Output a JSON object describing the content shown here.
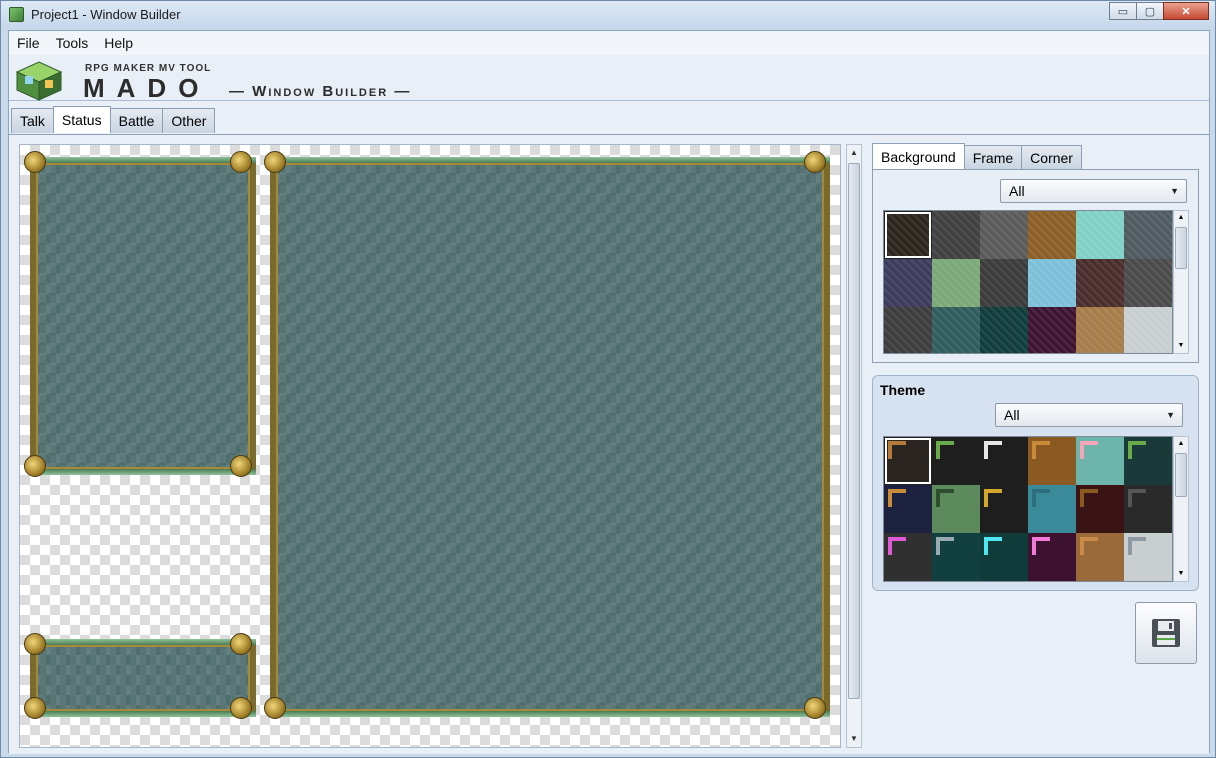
{
  "window": {
    "title": "Project1 - Window Builder",
    "minimize": "▭",
    "maximize": "▢",
    "close": "✕"
  },
  "menu": [
    "File",
    "Tools",
    "Help"
  ],
  "banner": {
    "subtitle": "RPG MAKER MV TOOL",
    "name": "MADO",
    "tagline": "— Window Builder —"
  },
  "tabs": [
    "Talk",
    "Status",
    "Battle",
    "Other"
  ],
  "active_tab": "Status",
  "right_tabs": [
    "Background",
    "Frame",
    "Corner"
  ],
  "active_right_tab": "Background",
  "background": {
    "filter": "All",
    "swatches": [
      "#2a241c",
      "#3f3f3f",
      "#5a5a5a",
      "#8b5d25",
      "#7fd1c6",
      "#4d5a5f",
      "#3b3a5c",
      "#7aa876",
      "#3a3a3a",
      "#7cc0d8",
      "#4a2c2c",
      "#4a4a4a",
      "#3c3c3c",
      "#2f5c5c",
      "#0f3b3b",
      "#3d1230",
      "#a67c4a",
      "#c9ced1"
    ]
  },
  "theme": {
    "title": "Theme",
    "filter": "All",
    "swatches": [
      {
        "bg": "#2a2520",
        "accent": "#b57b3a"
      },
      {
        "bg": "#1e1e1e",
        "accent": "#6aaa4a"
      },
      {
        "bg": "#1e1e1e",
        "accent": "#e6e6e6"
      },
      {
        "bg": "#8b5a22",
        "accent": "#c98a3a"
      },
      {
        "bg": "#6db5ab",
        "accent": "#f2a6b8"
      },
      {
        "bg": "#1a3a3a",
        "accent": "#6aaa4a"
      },
      {
        "bg": "#1d2240",
        "accent": "#c98a3a"
      },
      {
        "bg": "#5c8a5c",
        "accent": "#2e4e2e"
      },
      {
        "bg": "#1e1e1e",
        "accent": "#d4a72c"
      },
      {
        "bg": "#3a8a9a",
        "accent": "#2e6e7e"
      },
      {
        "bg": "#3a1414",
        "accent": "#8b5a22"
      },
      {
        "bg": "#2a2a2a",
        "accent": "#555555"
      },
      {
        "bg": "#303030",
        "accent": "#e05ad8"
      },
      {
        "bg": "#124040",
        "accent": "#9aa9b0"
      },
      {
        "bg": "#0f3b3b",
        "accent": "#4fe6f0"
      },
      {
        "bg": "#3d1230",
        "accent": "#f07ad8"
      },
      {
        "bg": "#9a6a3a",
        "accent": "#c98a4a"
      },
      {
        "bg": "#c9ced1",
        "accent": "#8e9aa3"
      }
    ]
  },
  "save_icon": "save-icon"
}
